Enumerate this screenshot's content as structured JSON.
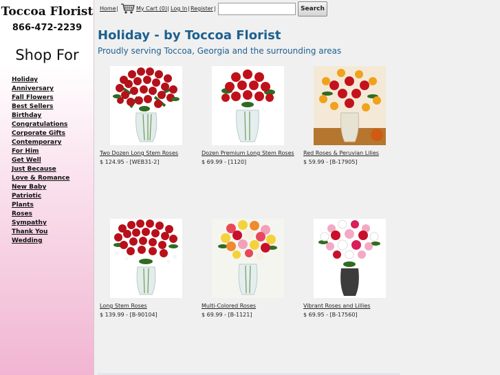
{
  "sidebar": {
    "brand": "Toccoa Florist",
    "phone": "866-472-2239",
    "shop_for": "Shop For",
    "categories": [
      "Holiday",
      "Anniversary",
      "Fall Flowers",
      "Best Sellers",
      "Birthday",
      "Congratulations",
      "Corporate Gifts",
      "Contemporary",
      "For Him",
      "Get Well",
      "Just Because",
      "Love & Romance",
      "New Baby",
      "Patriotic",
      "Plants",
      "Roses",
      "Sympathy",
      "Thank You",
      "Wedding"
    ]
  },
  "topbar": {
    "home": "Home",
    "cart": "My Cart (0)",
    "login": "Log In",
    "register": "Register",
    "separator": "|",
    "search_value": "",
    "search_button": "Search",
    "cart_icon": "shopping-cart-icon"
  },
  "main": {
    "title": "Holiday - by Toccoa Florist",
    "subtitle": "Proudly serving Toccoa, Georgia and the surrounding areas",
    "products": [
      {
        "name": "Two Dozen Long Stem Roses",
        "price": "$ 124.95 - [WEB31-2]"
      },
      {
        "name": "Dozen Premium Long Stem Roses",
        "price": "$ 69.99 - [1120]"
      },
      {
        "name": "Red Roses & Peruvian Lilies",
        "price": "$ 59.99 - [B-17905]"
      },
      {
        "name": "Long Stem Roses",
        "price": "$ 139.99 - [B-90104]"
      },
      {
        "name": "Multi-Colored Roses",
        "price": "$ 69.99 - [B-1121]"
      },
      {
        "name": "Vibrant Roses and Lillies",
        "price": "$ 69.95 - [B-17560]"
      }
    ]
  },
  "colors": {
    "title": "#1d6090",
    "sidebar_pink": "#f1b5d2",
    "rose_red": "#c0101a"
  }
}
